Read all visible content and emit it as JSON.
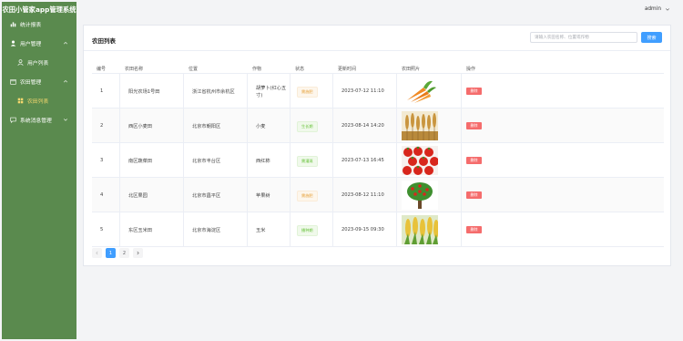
{
  "app": {
    "title": "农田小管家app管理系统"
  },
  "sidebar": {
    "items": [
      {
        "label": "统计报表"
      },
      {
        "label": "用户管理"
      },
      {
        "label": "用户列表"
      },
      {
        "label": "农田管理"
      },
      {
        "label": "农田列表"
      },
      {
        "label": "系统消息管理"
      }
    ]
  },
  "header": {
    "user": "admin"
  },
  "main": {
    "title": "农田列表",
    "search_placeholder": "请输入农田名称、位置或作物",
    "search_button": "搜索",
    "columns": [
      "编号",
      "农田名称",
      "位置",
      "作物",
      "状态",
      "更新时间",
      "农田照片",
      "操作"
    ],
    "rows": [
      {
        "id": "1",
        "name": "阳光农场1号田",
        "location": "浙江省杭州市余杭区",
        "crop": "胡萝卜(红心五寸)",
        "status": "需施肥",
        "time": "2023-07-12 11:10",
        "photo": "carrot-photo",
        "action": "删除"
      },
      {
        "id": "2",
        "name": "西区小麦田",
        "location": "北京市朝阳区",
        "crop": "小麦",
        "status": "生长期",
        "time": "2023-08-14 14:20",
        "photo": "wheat-photo",
        "action": "删除"
      },
      {
        "id": "3",
        "name": "南区蔬菜田",
        "location": "北京市丰台区",
        "crop": "西红柿",
        "status": "需灌溉",
        "time": "2023-07-13 16:45",
        "photo": "tomato-photo",
        "action": "删除"
      },
      {
        "id": "4",
        "name": "北区果园",
        "location": "北京市昌平区",
        "crop": "苹果树",
        "status": "需施肥",
        "time": "2023-08-12 11:10",
        "photo": "apple-tree-photo",
        "action": "删除"
      },
      {
        "id": "5",
        "name": "东区玉米田",
        "location": "北京市海淀区",
        "crop": "玉米",
        "status": "播种期",
        "time": "2023-09-15 09:30",
        "photo": "corn-photo",
        "action": "删除"
      }
    ],
    "pagination": {
      "pages": [
        "1",
        "2"
      ],
      "current": "1"
    }
  },
  "colors": {
    "sidebar": "#5a8a4e",
    "active": "#f5d76e",
    "primary": "#409eff",
    "danger": "#f56c6c"
  }
}
